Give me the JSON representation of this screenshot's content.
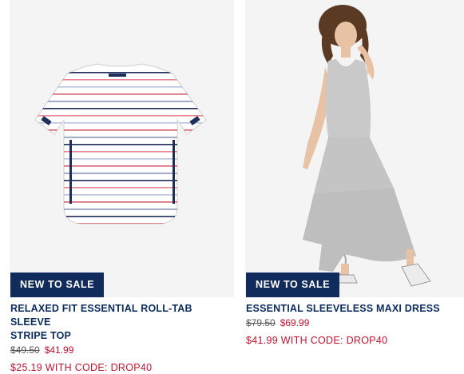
{
  "products": [
    {
      "badge": "NEW TO SALE",
      "title_line1": "RELAXED FIT ESSENTIAL ROLL-TAB SLEEVE",
      "title_line2": "STRIPE TOP",
      "original_price": "$49.50",
      "sale_price": "$41.99",
      "code_price": "$25.19 WITH CODE: DROP40",
      "image": "striped-top-image"
    },
    {
      "badge": "NEW TO SALE",
      "title_line1": "ESSENTIAL SLEEVELESS MAXI DRESS",
      "title_line2": "",
      "original_price": "$79.50",
      "sale_price": "$69.99",
      "code_price": "$41.99 WITH CODE: DROP40",
      "image": "maxi-dress-image"
    }
  ],
  "colors": {
    "navy": "#102b5c",
    "sale_red": "#c8102e",
    "image_bg": "#f4f4f4"
  }
}
